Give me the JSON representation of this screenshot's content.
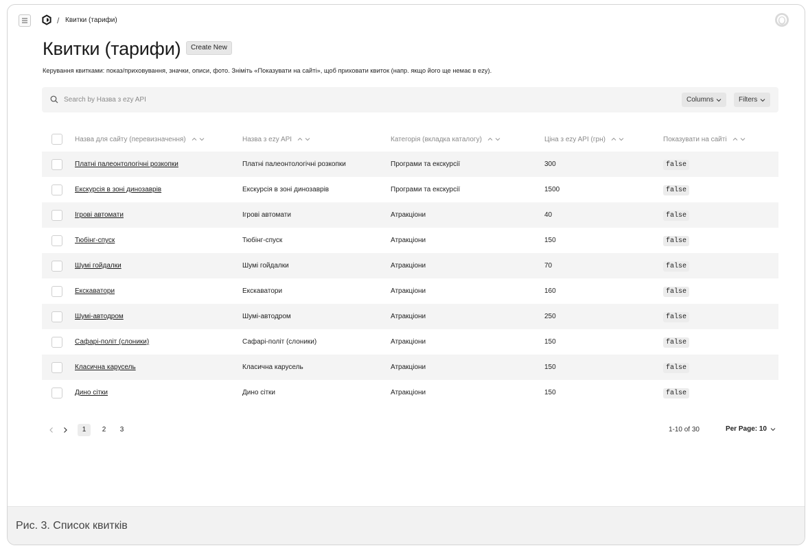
{
  "app": {
    "breadcrumb_sep": "/",
    "breadcrumb": "Квитки (тарифи)",
    "logo_icon": "hexagon-logo-icon",
    "menu_icon": "hamburger-icon",
    "avatar_icon": "user-avatar-icon"
  },
  "header": {
    "title": "Квитки (тарифи)",
    "create_label": "Create New",
    "description": "Керування квитками: показ/приховування, значки, описи, фото. Зніміть «Показувати на сайті», щоб приховати квиток (напр. якщо його ще немає в ezy)."
  },
  "search": {
    "placeholder": "Search by Назва з ezy API",
    "value": "",
    "columns_label": "Columns",
    "filters_label": "Filters"
  },
  "table": {
    "columns": [
      "Назва для сайту (перевизначення)",
      "Назва з ezy API",
      "Категорія (вкладка каталогу)",
      "Ціна з ezy API (грн)",
      "Показувати на сайті"
    ],
    "rows": [
      {
        "site_name": "Платні палеонтологічні розкопки",
        "api_name": "Платні палеонтологічні розкопки",
        "category": "Програми та екскурсії",
        "price": "300",
        "visible": "false"
      },
      {
        "site_name": "Екскурсія в зоні динозаврів",
        "api_name": "Екскурсія в зоні динозаврів",
        "category": "Програми та екскурсії",
        "price": "1500",
        "visible": "false"
      },
      {
        "site_name": "Ігрові автомати",
        "api_name": "Ігрові автомати",
        "category": "Атракціони",
        "price": "40",
        "visible": "false"
      },
      {
        "site_name": "Тюбінг-спуск",
        "api_name": "Тюбінг-спуск",
        "category": "Атракціони",
        "price": "150",
        "visible": "false"
      },
      {
        "site_name": "Шумі гойдалки",
        "api_name": "Шумі гойдалки",
        "category": "Атракціони",
        "price": "70",
        "visible": "false"
      },
      {
        "site_name": "Екскаватори",
        "api_name": "Екскаватори",
        "category": "Атракціони",
        "price": "160",
        "visible": "false"
      },
      {
        "site_name": "Шумі-автодром",
        "api_name": "Шумі-автодром",
        "category": "Атракціони",
        "price": "250",
        "visible": "false"
      },
      {
        "site_name": "Сафарі-політ (слоники)",
        "api_name": "Сафарі-політ (слоники)",
        "category": "Атракціони",
        "price": "150",
        "visible": "false"
      },
      {
        "site_name": "Класична карусель",
        "api_name": "Класична карусель",
        "category": "Атракціони",
        "price": "150",
        "visible": "false"
      },
      {
        "site_name": "Дино сітки",
        "api_name": "Дино сітки",
        "category": "Атракціони",
        "price": "150",
        "visible": "false"
      }
    ]
  },
  "pagination": {
    "pages": [
      "1",
      "2",
      "3"
    ],
    "current": "1",
    "range": "1-10 of 30",
    "per_page_label": "Per Page: 10"
  },
  "caption": "Рис. 3. Список квитків",
  "colors": {
    "row_shade": "#f4f4f4",
    "toolbar_bg": "#f4f4f4",
    "caption_bg": "#f2f2f2"
  }
}
